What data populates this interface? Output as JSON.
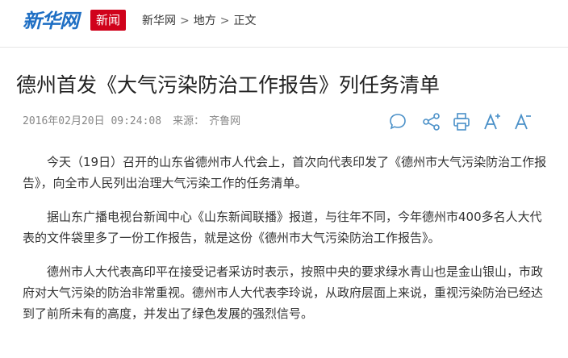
{
  "header": {
    "logo_text": "新华网",
    "channel_label": "新闻",
    "breadcrumb": [
      "新华网",
      "地方",
      "正文"
    ],
    "breadcrumb_separator": ">"
  },
  "article": {
    "title": "德州首发《大气污染防治工作报告》列任务清单",
    "date": "2016年02月20日 09:24:08",
    "source_label": "来源：",
    "source": "齐鲁网",
    "paragraphs": [
      "今天（19日）召开的山东省德州市人代会上，首次向代表印发了《德州市大气污染防治工作报告》，向全市人民列出治理大气污染工作的任务清单。",
      "据山东广播电视台新闻中心《山东新闻联播》报道，与往年不同，今年德州市400多名人大代表的文件袋里多了一份工作报告，就是这份《德州市大气污染防治工作报告》。",
      "德州市人大代表高印平在接受记者采访时表示，按照中央的要求绿水青山也是金山银山，市政府对大气污染的防治非常重视。德州市人大代表李玲说，从政府层面上来说，重视污染防治已经达到了前所未有的高度，并发出了绿色发展的强烈信号。"
    ]
  },
  "share_icons": [
    "comment-icon",
    "share-icon",
    "print-icon",
    "font-increase-icon",
    "font-decrease-icon"
  ],
  "colors": {
    "logo": "#1f6fc4",
    "badge": "#d0021b",
    "icon": "#4a90c8"
  }
}
